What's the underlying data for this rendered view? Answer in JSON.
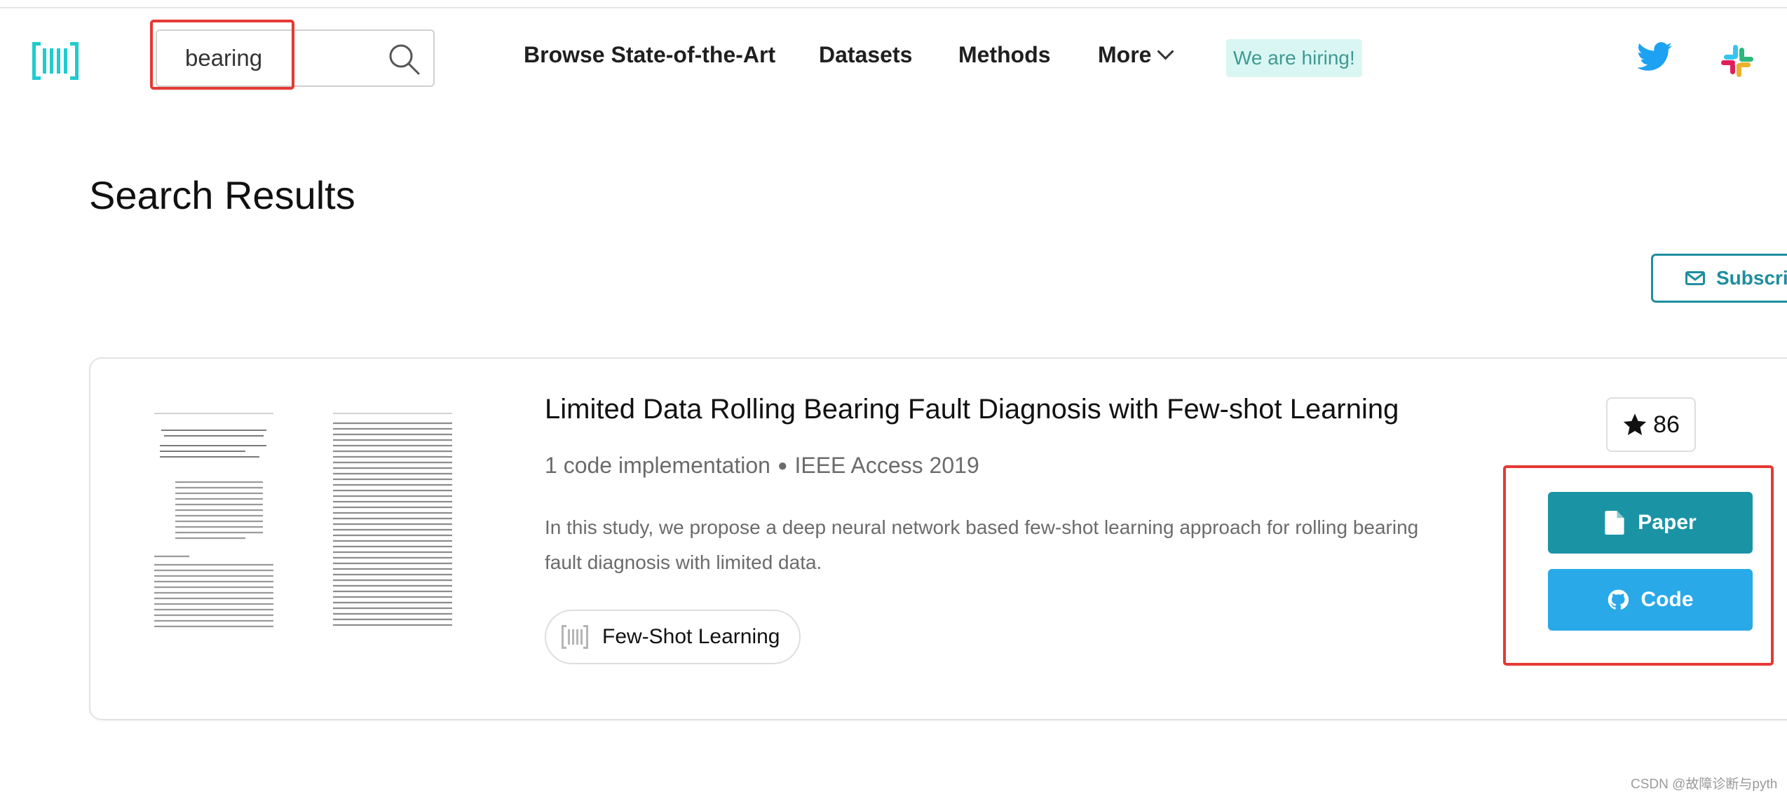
{
  "header": {
    "logo_icon": "paperswithcode-logo-icon",
    "search": {
      "value": "bearing",
      "icon": "search-icon"
    },
    "nav": [
      {
        "label": "Browse State-of-the-Art"
      },
      {
        "label": "Datasets"
      },
      {
        "label": "Methods"
      },
      {
        "label": "More"
      }
    ],
    "hiring_label": "We are hiring!",
    "social_icons": [
      "twitter-icon",
      "slack-icon"
    ]
  },
  "main": {
    "page_title": "Search Results",
    "subscribe_label": "Subscribe",
    "subscribe_icon": "mail-icon",
    "results": [
      {
        "title": "Limited Data Rolling Bearing Fault Diagnosis with Few-shot Learning",
        "code_implementations": "1 code implementation",
        "venue": "IEEE Access 2019",
        "abstract": "In this study, we propose a deep neural network based few-shot learning approach for rolling bearing fault diagnosis with limited data.",
        "tag": "Few-Shot Learning",
        "stars": "86",
        "paper_button": "Paper",
        "code_button": "Code"
      }
    ]
  },
  "colors": {
    "brand_teal": "#1a94a5",
    "code_blue": "#29a9e8",
    "annotation_red": "#e53935",
    "hiring_bg": "#d9f6f3"
  },
  "watermark": "CSDN @故障诊断与pyth"
}
